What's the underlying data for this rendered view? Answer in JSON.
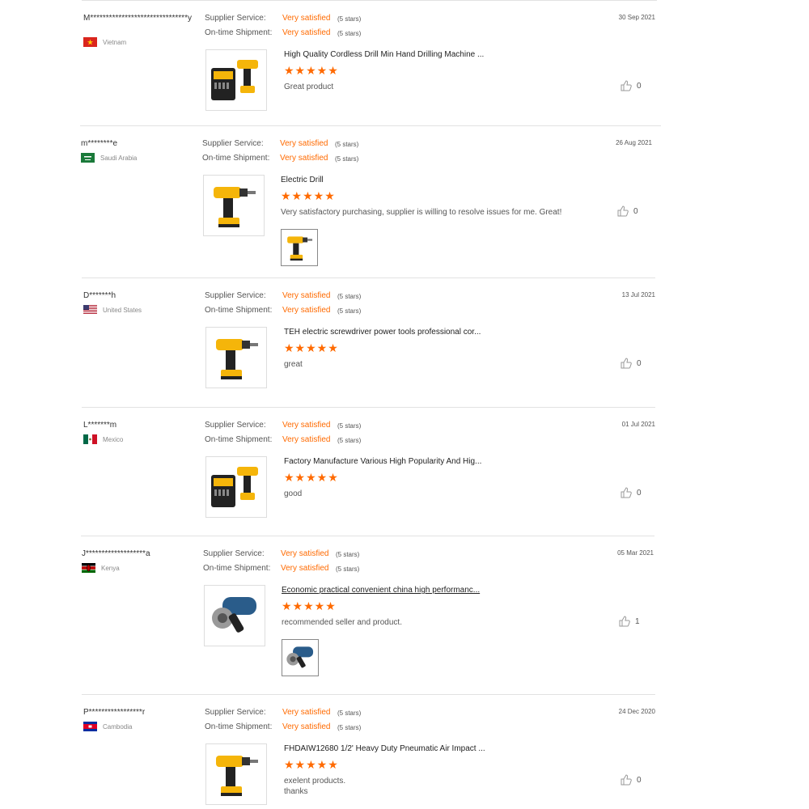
{
  "labels": {
    "supplier_service": "Supplier Service:",
    "ontime_shipment": "On-time Shipment:"
  },
  "colors": {
    "accent": "#ff6a00",
    "separator": "#e2e2e2"
  },
  "reviews": [
    {
      "user": "M*******************************y",
      "country": "Vietnam",
      "flag": "vietnam-flag",
      "supplier_rating": "Very satisfied",
      "supplier_stars": "(5 stars)",
      "shipment_rating": "Very satisfied",
      "shipment_stars": "(5 stars)",
      "date": "30 Sep 2021",
      "product": "High Quality Cordless Drill Min Hand Drilling Machine ...",
      "rating": 5,
      "comment": "Great product",
      "likes": "0",
      "thumb_icon": "drill-kit-icon"
    },
    {
      "user": "m********e",
      "country": "Saudi Arabia",
      "flag": "saudi-arabia-flag",
      "supplier_rating": "Very satisfied",
      "supplier_stars": "(5 stars)",
      "shipment_rating": "Very satisfied",
      "shipment_stars": "(5 stars)",
      "date": "26 Aug 2021",
      "product": "Electric Drill",
      "rating": 5,
      "comment": "Very satisfactory purchasing, supplier is willing to resolve issues for me. Great!",
      "likes": "0",
      "thumb_icon": "drill-icon",
      "has_photo": true
    },
    {
      "user": "D*******h",
      "country": "United States",
      "flag": "usa-flag",
      "supplier_rating": "Very satisfied",
      "supplier_stars": "(5 stars)",
      "shipment_rating": "Very satisfied",
      "shipment_stars": "(5 stars)",
      "date": "13 Jul 2021",
      "product": "TEH electric screwdriver power tools professional cor...",
      "rating": 5,
      "comment": "great",
      "likes": "0",
      "thumb_icon": "drill-icon"
    },
    {
      "user": "L*******m",
      "country": "Mexico",
      "flag": "mexico-flag",
      "supplier_rating": "Very satisfied",
      "supplier_stars": "(5 stars)",
      "shipment_rating": "Very satisfied",
      "shipment_stars": "(5 stars)",
      "date": "01 Jul 2021",
      "product": "Factory Manufacture Various High Popularity And Hig...",
      "rating": 5,
      "comment": "good",
      "likes": "0",
      "thumb_icon": "drill-kit-icon"
    },
    {
      "user": "J*******************a",
      "country": "Kenya",
      "flag": "kenya-flag",
      "supplier_rating": "Very satisfied",
      "supplier_stars": "(5 stars)",
      "shipment_rating": "Very satisfied",
      "shipment_stars": "(5 stars)",
      "date": "05 Mar 2021",
      "product": "Economic practical convenient china high performanc...",
      "rating": 5,
      "comment": "recommended seller and product.",
      "likes": "1",
      "thumb_icon": "angle-grinder-icon",
      "has_photo": true,
      "product_link": true
    },
    {
      "user": "P*****************r",
      "country": "Cambodia",
      "flag": "cambodia-flag",
      "supplier_rating": "Very satisfied",
      "supplier_stars": "(5 stars)",
      "shipment_rating": "Very satisfied",
      "shipment_stars": "(5 stars)",
      "date": "24 Dec 2020",
      "product": "FHDAIW12680 1/2' Heavy Duty Pneumatic Air Impact ...",
      "rating": 5,
      "comment": "exelent products.\nthanks",
      "likes": "0",
      "thumb_icon": "drill-icon"
    }
  ]
}
